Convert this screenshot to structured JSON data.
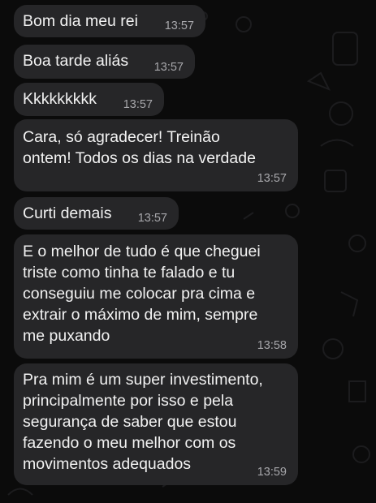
{
  "chat": {
    "messages": [
      {
        "text": "Bom dia meu rei",
        "time": "13:57"
      },
      {
        "text": "Boa tarde aliás",
        "time": "13:57"
      },
      {
        "text": "Kkkkkkkkk",
        "time": "13:57"
      },
      {
        "lines": [
          "Cara, só agradecer! Treinão",
          "ontem! Todos os dias na verdade"
        ],
        "time": "13:57"
      },
      {
        "text": "Curti demais",
        "time": "13:57"
      },
      {
        "lines": [
          "E o melhor de tudo é que cheguei",
          "triste como tinha te falado e tu",
          "conseguiu me colocar pra cima e",
          "extrair o máximo de mim, sempre",
          "me puxando"
        ],
        "time": "13:58"
      },
      {
        "lines": [
          "Pra mim é um super investimento,",
          "principalmente por isso e pela",
          "segurança de saber que estou",
          "fazendo o meu melhor com os",
          "movimentos adequados"
        ],
        "time": "13:59"
      }
    ]
  },
  "colors": {
    "background": "#0b0b0b",
    "bubble": "#262628",
    "text": "#f2f2f2",
    "timestamp": "#a7a7ab"
  }
}
